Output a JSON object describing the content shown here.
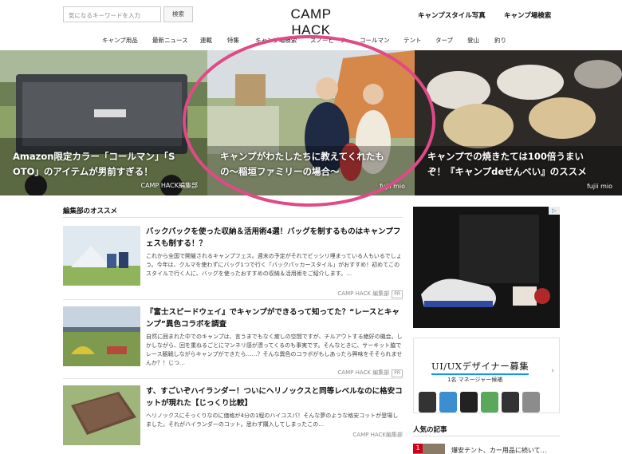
{
  "header": {
    "search_placeholder": "気になるキーワードを入力",
    "search_button": "検索",
    "logo": "CAMP HACK",
    "links": [
      "キャンプスタイル写真",
      "キャンプ場検索"
    ]
  },
  "nav": {
    "items": [
      "キャンプ用品",
      "最新ニュース",
      "連載",
      "特集",
      "キャンプ場検索",
      "スノーピーク",
      "コールマン",
      "テント",
      "タープ",
      "登山",
      "釣り"
    ]
  },
  "hero": [
    {
      "title_line1": "Amazon限定カラー「コールマン」「S",
      "title_line2": "OTO」のアイテムが男前すぎる！",
      "author": "CAMP HACK編集部"
    },
    {
      "title_line1": "キャンプがわたしたちに教えてくれたも",
      "title_line2": "の〜稲垣ファミリーの場合〜",
      "author": "fujii mio"
    },
    {
      "title_line1": "キャンプでの焼きたては100倍うまい",
      "title_line2": "ぞ！『キャンプdeせんべい』のススメ",
      "author": "fujii mio"
    }
  ],
  "recommend": {
    "section_title": "編集部のオススメ",
    "articles": [
      {
        "title": "バックパックを使った収納＆活用術4選！バッグを制するものはキャンプフェスも制する！？",
        "desc": "これから全国で開催されるキャンプフェス。週末の予定がそれでビッシリ埋まっている人もいるでしょう。今年は、クルマを使わずにバッグ1つで行く「バックパッカースタイル」がおすすめ！初めてこのスタイルで行く人に、バッグを使ったおすすめの収納＆活用術をご紹介します。…",
        "author": "CAMP HACK 編集部",
        "badge": "PR"
      },
      {
        "title": "『富士スピードウェイ』でキャンプができるって知ってた？“レースとキャンプ”異色コラボを調査",
        "desc": "自然に囲まれた中でのキャンプは、言うまでもなく癒しの空間ですが、チルアウトする絶好の機会。しかしながら、回を重ねるごとにマンネリ感が漂ってくるのも事実です。そんなときに、サーキット脇でレース観戦しながらキャンプができたら……？そんな異色のコラボがもしあったら興味をそそられませんか？！じつ…",
        "author": "CAMP HACK 編集部",
        "badge": "PR"
      },
      {
        "title": "す、すごいぞハイランダー！ついにヘリノックスと同等レベルなのに格安コットが現れた【じっくり比較】",
        "desc": "ヘリノックスにそっくりなのに価格が4分の1程のハイコスパ！そんな夢のような格安コットが登場しました。それがハイランダーのコット。思わず購入してしまったこの…",
        "author": "CAMP HACK編集部",
        "badge": ""
      }
    ]
  },
  "sidebar": {
    "ad_label": "▷",
    "recruit_title": "UI/UXデザイナー募集",
    "recruit_sub": "1名 マネージャー候補",
    "popular_title": "人気の記事",
    "popular_rank": "1",
    "popular_text": "爆安テント、カー用品に続いて…"
  },
  "colors": {
    "highlight_ring": "#e04a86",
    "rank": "#d0021b",
    "accent": "#0a9ce0"
  }
}
